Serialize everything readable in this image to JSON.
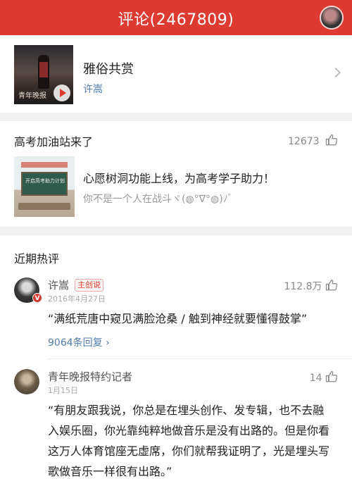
{
  "header": {
    "title": "评论(2467809)"
  },
  "song": {
    "title": "雅俗共赏",
    "artist": "许嵩",
    "cover_text": "青年晚报"
  },
  "promo": {
    "title": "高考加油站来了",
    "likes": "12673",
    "main": "心愿树洞功能上线，为高考学子助力！",
    "sub": "你不是一个人在战斗ヾ(◍°∇°◍)ﾉﾞ",
    "board_text": "开启高考助力计划"
  },
  "hot": {
    "label": "近期热评",
    "comments": [
      {
        "user": "许嵩",
        "badge": "主创说",
        "verified": "V",
        "date": "2016年4月27日",
        "likes": "112.8万",
        "text": "“满纸荒唐中窥见满脸沧桑 / 触到神经就要懂得鼓掌”",
        "replies": "9064条回复 ›"
      },
      {
        "user": "青年晚报特约记者",
        "date": "1月15日",
        "likes": "14",
        "text": "“有朋友跟我说，你总是在埋头创作、发专辑，也不去融入娱乐圈，你光靠纯粹地做音乐是没有出路的。但是你看这万人体育馆座无虚席，你们就帮我证明了，光是埋头写歌做音乐一样很有出路。”"
      }
    ]
  }
}
